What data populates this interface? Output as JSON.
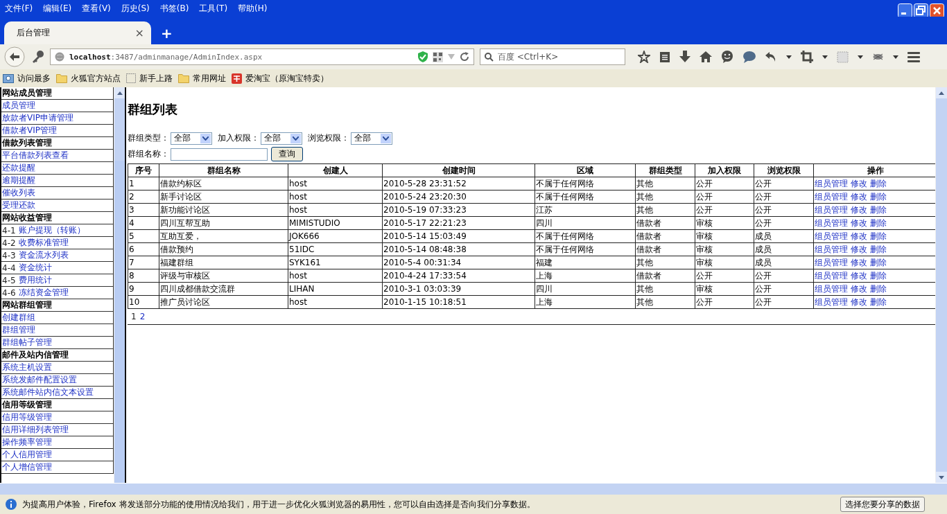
{
  "menubar": [
    "文件(F)",
    "编辑(E)",
    "查看(V)",
    "历史(S)",
    "书签(B)",
    "工具(T)",
    "帮助(H)"
  ],
  "tab": {
    "title": "后台管理",
    "close": "×",
    "new": "+"
  },
  "address": {
    "host": "localhost",
    "path": ":3487/adminmanage/AdminIndex.aspx"
  },
  "search": {
    "placeholder": "百度 <Ctrl+K>"
  },
  "bookmarks": [
    {
      "label": "访问最多",
      "kind": "frequent"
    },
    {
      "label": "火狐官方站点",
      "kind": "folder"
    },
    {
      "label": "新手上路",
      "kind": "blank"
    },
    {
      "label": "常用网址",
      "kind": "folder"
    },
    {
      "label": "爱淘宝（原淘宝特卖）",
      "kind": "shop"
    }
  ],
  "sidebar": [
    {
      "kind": "header",
      "label": "网站成员管理"
    },
    {
      "kind": "link",
      "label": "成员管理"
    },
    {
      "kind": "link",
      "label": "放款者VIP申请管理"
    },
    {
      "kind": "link",
      "label": "借款者VIP管理"
    },
    {
      "kind": "header",
      "label": "借款列表管理"
    },
    {
      "kind": "link",
      "label": "平台借款列表查看"
    },
    {
      "kind": "link",
      "label": "还款提醒"
    },
    {
      "kind": "link",
      "label": "逾期提醒"
    },
    {
      "kind": "link",
      "label": "催收列表"
    },
    {
      "kind": "link",
      "label": "受理还款"
    },
    {
      "kind": "header",
      "label": "网站收益管理"
    },
    {
      "kind": "numbered",
      "prefix": "4-1",
      "label": "账户提现（转账）"
    },
    {
      "kind": "numbered",
      "prefix": "4-2",
      "label": "收费标准管理"
    },
    {
      "kind": "numbered",
      "prefix": "4-3",
      "label": "资金流水列表"
    },
    {
      "kind": "numbered",
      "prefix": "4-4",
      "label": "资金统计"
    },
    {
      "kind": "numbered",
      "prefix": "4-5",
      "label": "费用统计"
    },
    {
      "kind": "numbered",
      "prefix": "4-6",
      "label": "冻结资金管理"
    },
    {
      "kind": "header",
      "label": "网站群组管理"
    },
    {
      "kind": "link",
      "label": "创建群组"
    },
    {
      "kind": "link",
      "label": "群组管理"
    },
    {
      "kind": "link",
      "label": "群组帖子管理"
    },
    {
      "kind": "header",
      "label": "邮件及站内信管理"
    },
    {
      "kind": "link",
      "label": "系统主机设置"
    },
    {
      "kind": "link",
      "label": "系统发邮件配置设置"
    },
    {
      "kind": "link",
      "label": "系统邮件站内信文本设置"
    },
    {
      "kind": "header",
      "label": "信用等级管理"
    },
    {
      "kind": "link",
      "label": "信用等级管理"
    },
    {
      "kind": "link",
      "label": "信用详细列表管理"
    },
    {
      "kind": "link",
      "label": "操作频率管理"
    },
    {
      "kind": "link",
      "label": "个人信用管理"
    },
    {
      "kind": "link",
      "label": "个人增信管理"
    }
  ],
  "page": {
    "title": "群组列表",
    "filters": [
      {
        "label": "群组类型：",
        "value": "全部"
      },
      {
        "label": "加入权限：",
        "value": "全部"
      },
      {
        "label": "浏览权限：",
        "value": "全部"
      }
    ],
    "name_field": {
      "label": "群组名称："
    },
    "query_button": "查询",
    "table": {
      "columns": [
        "序号",
        "群组名称",
        "创建人",
        "创建时间",
        "区域",
        "群组类型",
        "加入权限",
        "浏览权限",
        "操作"
      ],
      "rows": [
        {
          "cells": [
            "1",
            "借款约标区",
            "host",
            "2010-5-28 23:31:52",
            "不属于任何网络",
            "其他",
            "公开",
            "公开"
          ],
          "actions": [
            "组员管理",
            "修改",
            "删除"
          ]
        },
        {
          "cells": [
            "2",
            "新手讨论区",
            "host",
            "2010-5-24 23:20:30",
            "不属于任何网络",
            "其他",
            "公开",
            "公开"
          ],
          "actions": [
            "组员管理",
            "修改",
            "删除"
          ]
        },
        {
          "cells": [
            "3",
            "新功能讨论区",
            "host",
            "2010-5-19 07:33:23",
            "江苏",
            "其他",
            "公开",
            "公开"
          ],
          "actions": [
            "组员管理",
            "修改",
            "删除"
          ]
        },
        {
          "cells": [
            "4",
            "四川互帮互助",
            "MIMISTUDIO",
            "2010-5-17 22:21:23",
            "四川",
            "借款者",
            "审核",
            "公开"
          ],
          "actions": [
            "组员管理",
            "修改",
            "删除"
          ]
        },
        {
          "cells": [
            "5",
            "互助互爱，",
            "JOK666",
            "2010-5-14 15:03:49",
            "不属于任何网络",
            "借款者",
            "审核",
            "成员"
          ],
          "actions": [
            "组员管理",
            "修改",
            "删除"
          ]
        },
        {
          "cells": [
            "6",
            "借款预约",
            "51IDC",
            "2010-5-14 08:48:38",
            "不属于任何网络",
            "借款者",
            "审核",
            "成员"
          ],
          "actions": [
            "组员管理",
            "修改",
            "删除"
          ]
        },
        {
          "cells": [
            "7",
            "福建群组",
            "SYK161",
            "2010-5-4 00:31:34",
            "福建",
            "其他",
            "审核",
            "成员"
          ],
          "actions": [
            "组员管理",
            "修改",
            "删除"
          ]
        },
        {
          "cells": [
            "8",
            "评级与审核区",
            "host",
            "2010-4-24 17:33:54",
            "上海",
            "借款者",
            "公开",
            "公开"
          ],
          "actions": [
            "组员管理",
            "修改",
            "删除"
          ]
        },
        {
          "cells": [
            "9",
            "四川成都借款交流群",
            "LIHAN",
            "2010-3-1 03:03:39",
            "四川",
            "其他",
            "审核",
            "公开"
          ],
          "actions": [
            "组员管理",
            "修改",
            "删除"
          ]
        },
        {
          "cells": [
            "10",
            "推广员讨论区",
            "host",
            "2010-1-15 10:18:51",
            "上海",
            "其他",
            "公开",
            "公开"
          ],
          "actions": [
            "组员管理",
            "修改",
            "删除"
          ]
        }
      ]
    },
    "pager": [
      {
        "label": "1",
        "selected": true
      },
      {
        "label": "2",
        "selected": false
      }
    ]
  },
  "notification": {
    "text": "为提高用户体验，Firefox 将发送部分功能的使用情况给我们，用于进一步优化火狐浏览器的易用性，您可以自由选择是否向我们分享数据。",
    "button": "选择您要分享的数据"
  }
}
